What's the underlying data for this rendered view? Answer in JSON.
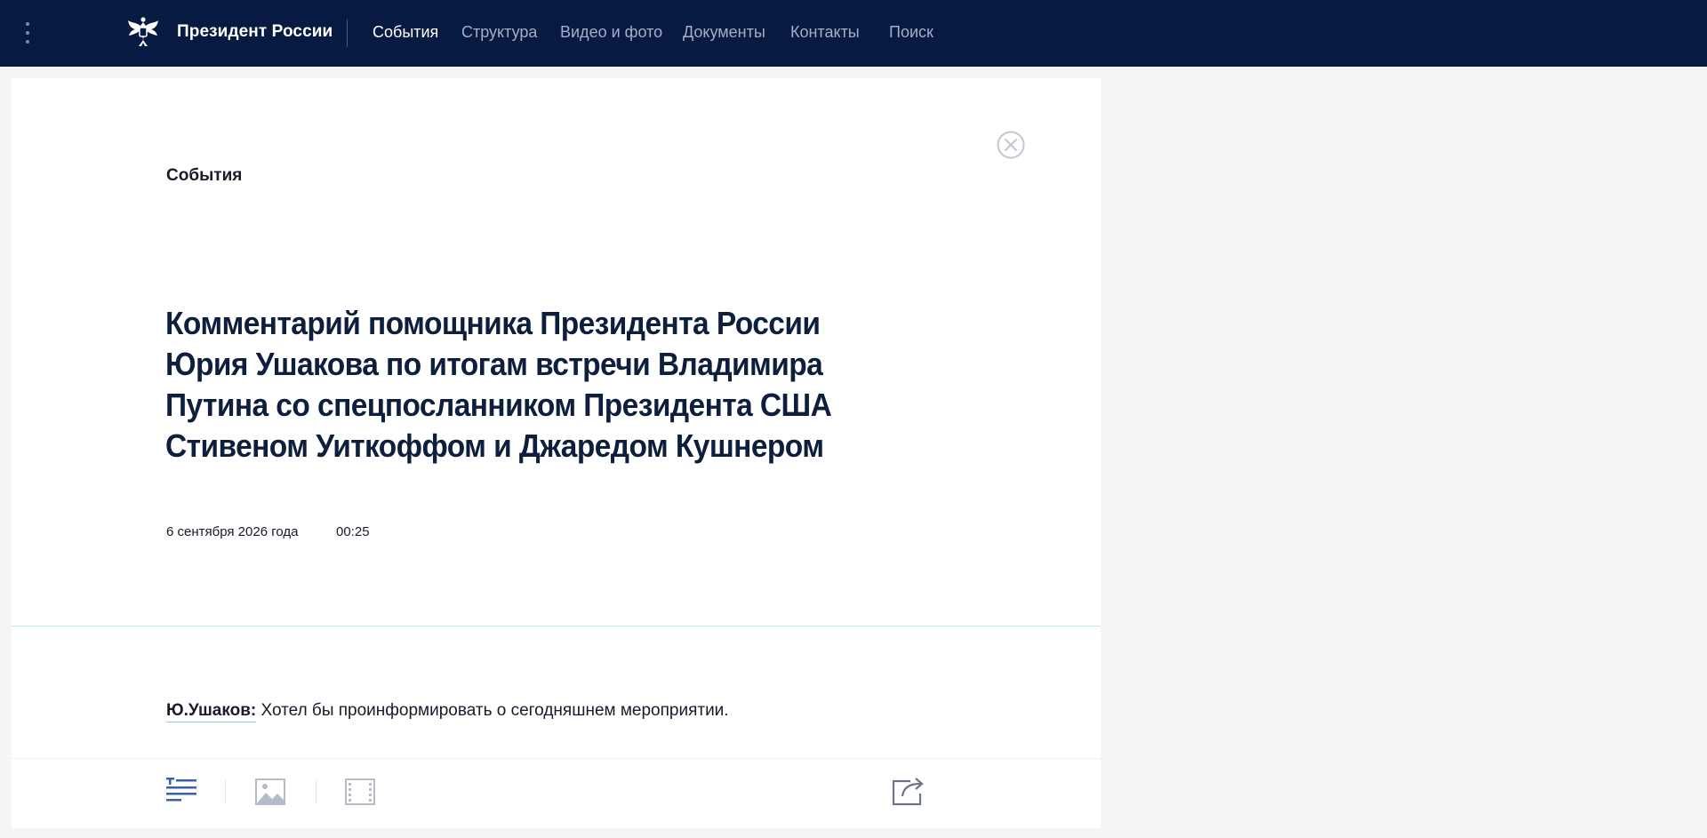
{
  "header": {
    "brand": "Президент России",
    "nav": [
      "События",
      "Структура",
      "Видео и фото",
      "Документы",
      "Контакты",
      "Поиск"
    ],
    "active_nav": "События"
  },
  "article": {
    "section": "События",
    "title": "Комментарий помощника Президента России Юрия Ушакова по итогам встречи Владимира Путина со спецпосланником Президента США Стивеном Уиткоффом и Джаредом Кушнером",
    "date": "6 сентября 2026 года",
    "time": "00:25",
    "speaker": "Ю.Ушаков:",
    "text": "Хотел бы проинформировать о сегодняшнем мероприятии."
  },
  "toolbar": {
    "icons": [
      "text-view-icon",
      "photo-view-icon",
      "video-view-icon",
      "share-icon"
    ]
  },
  "colors": {
    "header_bg": "#061a42",
    "accent_line": "#b9eadf",
    "icon_blue": "#3a5fb0",
    "icon_gray": "#b5bcc8"
  }
}
